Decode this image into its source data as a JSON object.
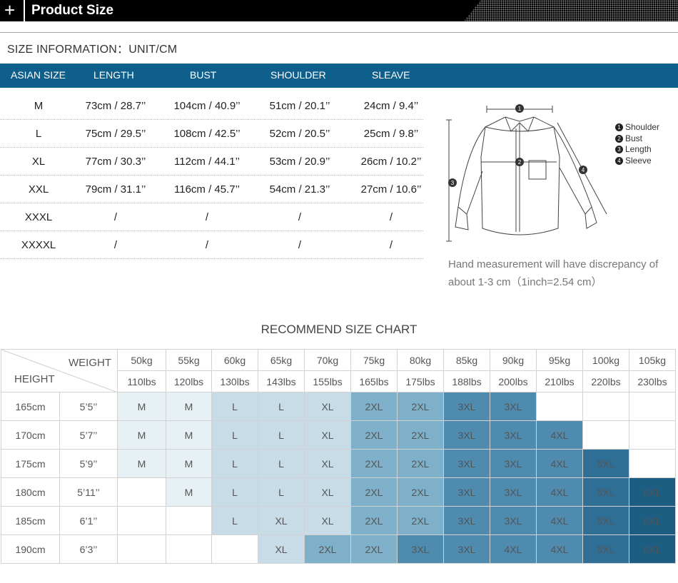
{
  "header": {
    "title": "Product Size",
    "plus": "+"
  },
  "size_info": "SIZE INFORMATION：UNIT/CM",
  "table": {
    "columns": [
      "ASIAN SIZE",
      "LENGTH",
      "BUST",
      "SHOULDER",
      "SLEAVE"
    ],
    "rows": [
      [
        "M",
        "73cm / 28.7’’",
        "104cm / 40.9’’",
        "51cm / 20.1’’",
        "24cm / 9.4’’"
      ],
      [
        "L",
        "75cm / 29.5’’",
        "108cm / 42.5’’",
        "52cm / 20.5’’",
        "25cm / 9.8’’"
      ],
      [
        "XL",
        "77cm / 30.3’’",
        "112cm / 44.1’’",
        "53cm / 20.9’’",
        "26cm / 10.2’’"
      ],
      [
        "XXL",
        "79cm / 31.1’’",
        "116cm / 45.7’’",
        "54cm / 21.3’’",
        "27cm / 10.6’’"
      ],
      [
        "XXXL",
        "/",
        "/",
        "/",
        "/"
      ],
      [
        "XXXXL",
        "/",
        "/",
        "/",
        "/"
      ]
    ]
  },
  "legend": [
    {
      "num": "1",
      "label": "Shoulder"
    },
    {
      "num": "2",
      "label": "Bust"
    },
    {
      "num": "3",
      "label": "Length"
    },
    {
      "num": "4",
      "label": "Sleeve"
    }
  ],
  "markers": [
    "1",
    "2",
    "3",
    "4"
  ],
  "note": "Hand measurement will have discrepancy of about 1-3 cm（1inch=2.54 cm）",
  "recommend": {
    "title": "RECOMMEND SIZE CHART",
    "weight_label": "WEIGHT",
    "height_label": "HEIGHT",
    "kg": [
      "50kg",
      "55kg",
      "60kg",
      "65kg",
      "70kg",
      "75kg",
      "80kg",
      "85kg",
      "90kg",
      "95kg",
      "100kg",
      "105kg"
    ],
    "lbs": [
      "110lbs",
      "120lbs",
      "130lbs",
      "143lbs",
      "155lbs",
      "165lbs",
      "175lbs",
      "188lbs",
      "200lbs",
      "210lbs",
      "220lbs",
      "230lbs"
    ],
    "rows": [
      {
        "cm": "165cm",
        "ft": "5’5’’",
        "sizes": [
          "M",
          "M",
          "L",
          "L",
          "XL",
          "2XL",
          "2XL",
          "3XL",
          "3XL",
          "",
          "",
          ""
        ]
      },
      {
        "cm": "170cm",
        "ft": "5’7’’",
        "sizes": [
          "M",
          "M",
          "L",
          "L",
          "XL",
          "2XL",
          "2XL",
          "3XL",
          "3XL",
          "4XL",
          "",
          ""
        ]
      },
      {
        "cm": "175cm",
        "ft": "5’9’’",
        "sizes": [
          "M",
          "M",
          "L",
          "L",
          "XL",
          "2XL",
          "2XL",
          "3XL",
          "3XL",
          "4XL",
          "5XL",
          ""
        ]
      },
      {
        "cm": "180cm",
        "ft": "5’11’’",
        "sizes": [
          "",
          "M",
          "L",
          "L",
          "XL",
          "2XL",
          "2XL",
          "3XL",
          "3XL",
          "4XL",
          "5XL",
          "5XL"
        ]
      },
      {
        "cm": "185cm",
        "ft": "6’1’’",
        "sizes": [
          "",
          "",
          "L",
          "XL",
          "XL",
          "2XL",
          "2XL",
          "3XL",
          "3XL",
          "4XL",
          "5XL",
          "5XL"
        ]
      },
      {
        "cm": "190cm",
        "ft": "6’3’’",
        "sizes": [
          "",
          "",
          "",
          "XL",
          "2XL",
          "2XL",
          "3XL",
          "3XL",
          "4XL",
          "4XL",
          "5XL",
          "5XL"
        ]
      }
    ]
  }
}
